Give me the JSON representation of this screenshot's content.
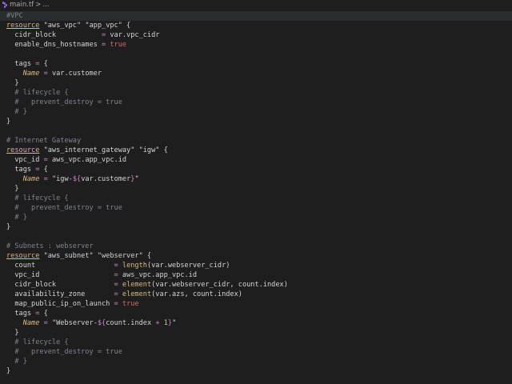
{
  "breadcrumb": {
    "file": "main.tf",
    "separator": ">",
    "trail": "..."
  },
  "lines": [
    [
      {
        "t": "cmt",
        "v": "#VPC"
      }
    ],
    [
      {
        "t": "kw",
        "v": "resource"
      },
      {
        "t": "plain",
        "v": " \"aws_vpc\" \"app_vpc\" {"
      }
    ],
    [
      {
        "t": "plain",
        "v": "  cidr_block           "
      },
      {
        "t": "op",
        "v": "="
      },
      {
        "t": "plain",
        "v": " var.vpc_cidr"
      }
    ],
    [
      {
        "t": "plain",
        "v": "  enable_dns_hostnames "
      },
      {
        "t": "op",
        "v": "="
      },
      {
        "t": "plain",
        "v": " "
      },
      {
        "t": "bool",
        "v": "true"
      }
    ],
    [],
    [
      {
        "t": "plain",
        "v": "  tags "
      },
      {
        "t": "op",
        "v": "="
      },
      {
        "t": "plain",
        "v": " {"
      }
    ],
    [
      {
        "t": "plain",
        "v": "    "
      },
      {
        "t": "italic-attr",
        "v": "Name"
      },
      {
        "t": "plain",
        "v": " "
      },
      {
        "t": "op",
        "v": "="
      },
      {
        "t": "plain",
        "v": " var.customer"
      }
    ],
    [
      {
        "t": "plain",
        "v": "  }"
      }
    ],
    [
      {
        "t": "cmt",
        "v": "  # lifecycle {"
      }
    ],
    [
      {
        "t": "cmt",
        "v": "  #   prevent_destroy = true"
      }
    ],
    [
      {
        "t": "cmt",
        "v": "  # }"
      }
    ],
    [
      {
        "t": "plain",
        "v": "}"
      }
    ],
    [],
    [
      {
        "t": "cmt",
        "v": "# Internet Gateway"
      }
    ],
    [
      {
        "t": "kw",
        "v": "resource"
      },
      {
        "t": "plain",
        "v": " \"aws_internet_gateway\" \"igw\" {"
      }
    ],
    [
      {
        "t": "plain",
        "v": "  vpc_id "
      },
      {
        "t": "op",
        "v": "="
      },
      {
        "t": "plain",
        "v": " aws_vpc.app_vpc.id"
      }
    ],
    [
      {
        "t": "plain",
        "v": "  tags "
      },
      {
        "t": "op",
        "v": "="
      },
      {
        "t": "plain",
        "v": " {"
      }
    ],
    [
      {
        "t": "plain",
        "v": "    "
      },
      {
        "t": "italic-attr",
        "v": "Name"
      },
      {
        "t": "plain",
        "v": " "
      },
      {
        "t": "op",
        "v": "="
      },
      {
        "t": "plain",
        "v": " \"igw-"
      },
      {
        "t": "interp",
        "v": "${"
      },
      {
        "t": "plain",
        "v": "var.customer"
      },
      {
        "t": "interp",
        "v": "}"
      },
      {
        "t": "plain",
        "v": "\""
      }
    ],
    [
      {
        "t": "plain",
        "v": "  }"
      }
    ],
    [
      {
        "t": "cmt",
        "v": "  # lifecycle {"
      }
    ],
    [
      {
        "t": "cmt",
        "v": "  #   prevent_destroy = true"
      }
    ],
    [
      {
        "t": "cmt",
        "v": "  # }"
      }
    ],
    [
      {
        "t": "plain",
        "v": "}"
      }
    ],
    [],
    [
      {
        "t": "cmt",
        "v": "# Subnets : webserver"
      }
    ],
    [
      {
        "t": "kw",
        "v": "resource"
      },
      {
        "t": "plain",
        "v": " \"aws_subnet\" \"webserver\" {"
      }
    ],
    [
      {
        "t": "plain",
        "v": "  count                   "
      },
      {
        "t": "op",
        "v": "="
      },
      {
        "t": "plain",
        "v": " "
      },
      {
        "t": "fn",
        "v": "length"
      },
      {
        "t": "plain",
        "v": "(var.webserver_cidr)"
      }
    ],
    [
      {
        "t": "plain",
        "v": "  vpc_id                  "
      },
      {
        "t": "op",
        "v": "="
      },
      {
        "t": "plain",
        "v": " aws_vpc.app_vpc.id"
      }
    ],
    [
      {
        "t": "plain",
        "v": "  cidr_block              "
      },
      {
        "t": "op",
        "v": "="
      },
      {
        "t": "plain",
        "v": " "
      },
      {
        "t": "fn",
        "v": "element"
      },
      {
        "t": "plain",
        "v": "(var.webserver_cidr, count.index)"
      }
    ],
    [
      {
        "t": "plain",
        "v": "  availability_zone       "
      },
      {
        "t": "op",
        "v": "="
      },
      {
        "t": "plain",
        "v": " "
      },
      {
        "t": "fn",
        "v": "element"
      },
      {
        "t": "plain",
        "v": "(var.azs, count.index)"
      }
    ],
    [
      {
        "t": "plain",
        "v": "  map_public_ip_on_launch "
      },
      {
        "t": "op",
        "v": "="
      },
      {
        "t": "plain",
        "v": " "
      },
      {
        "t": "bool",
        "v": "true"
      }
    ],
    [
      {
        "t": "plain",
        "v": "  tags "
      },
      {
        "t": "op",
        "v": "="
      },
      {
        "t": "plain",
        "v": " {"
      }
    ],
    [
      {
        "t": "plain",
        "v": "    "
      },
      {
        "t": "italic-attr",
        "v": "Name"
      },
      {
        "t": "plain",
        "v": " "
      },
      {
        "t": "op",
        "v": "="
      },
      {
        "t": "plain",
        "v": " \"Webserver-"
      },
      {
        "t": "interp",
        "v": "${"
      },
      {
        "t": "plain",
        "v": "count.index "
      },
      {
        "t": "op",
        "v": "+"
      },
      {
        "t": "plain",
        "v": " "
      },
      {
        "t": "num",
        "v": "1"
      },
      {
        "t": "interp",
        "v": "}"
      },
      {
        "t": "plain",
        "v": "\""
      }
    ],
    [
      {
        "t": "plain",
        "v": "  }"
      }
    ],
    [
      {
        "t": "cmt",
        "v": "  # lifecycle {"
      }
    ],
    [
      {
        "t": "cmt",
        "v": "  #   prevent_destroy = true"
      }
    ],
    [
      {
        "t": "cmt",
        "v": "  # }"
      }
    ],
    [
      {
        "t": "plain",
        "v": "}"
      }
    ]
  ]
}
